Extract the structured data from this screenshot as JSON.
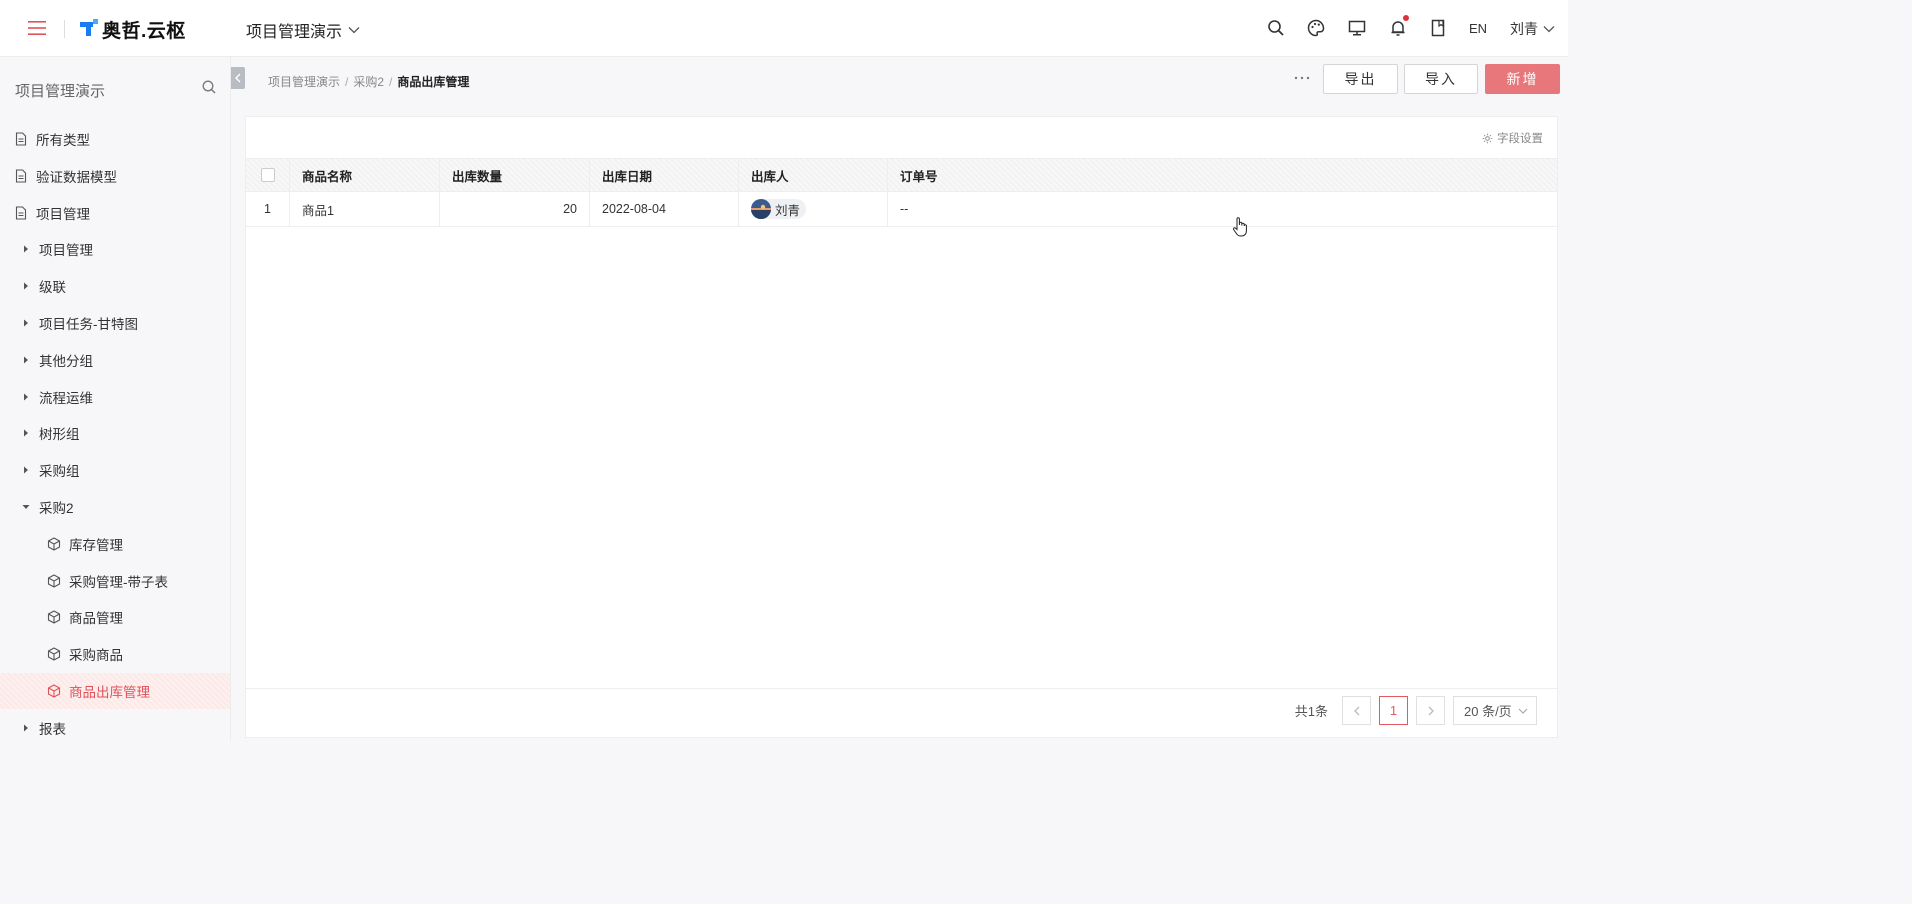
{
  "header": {
    "logo_text": "奥哲.云枢",
    "app_name": "项目管理演示",
    "lang": "EN",
    "user_name": "刘青",
    "icons": [
      "search-icon",
      "palette-icon",
      "monitor-icon",
      "bell-icon",
      "bookmark-icon"
    ]
  },
  "sidebar": {
    "title": "项目管理演示",
    "items": [
      {
        "label": "所有类型",
        "icon": "document-icon",
        "kind": "doc"
      },
      {
        "label": "验证数据模型",
        "icon": "document-icon",
        "kind": "doc"
      },
      {
        "label": "项目管理",
        "icon": "document-icon",
        "kind": "doc"
      },
      {
        "label": "项目管理",
        "icon": "caret-right-icon",
        "kind": "group"
      },
      {
        "label": "级联",
        "icon": "caret-right-icon",
        "kind": "group"
      },
      {
        "label": "项目任务-甘特图",
        "icon": "caret-right-icon",
        "kind": "group"
      },
      {
        "label": "其他分组",
        "icon": "caret-right-icon",
        "kind": "group"
      },
      {
        "label": "流程运维",
        "icon": "caret-right-icon",
        "kind": "group"
      },
      {
        "label": "树形组",
        "icon": "caret-right-icon",
        "kind": "group"
      },
      {
        "label": "采购组",
        "icon": "caret-right-icon",
        "kind": "group"
      },
      {
        "label": "采购2",
        "icon": "caret-down-icon",
        "kind": "group-open"
      },
      {
        "label": "库存管理",
        "icon": "cube-icon",
        "kind": "model"
      },
      {
        "label": "采购管理-带子表",
        "icon": "cube-icon",
        "kind": "model"
      },
      {
        "label": "商品管理",
        "icon": "cube-icon",
        "kind": "model"
      },
      {
        "label": "采购商品",
        "icon": "cube-icon",
        "kind": "model"
      },
      {
        "label": "商品出库管理",
        "icon": "cube-icon",
        "kind": "model",
        "active": true
      },
      {
        "label": "报表",
        "icon": "caret-right-icon",
        "kind": "group"
      }
    ]
  },
  "breadcrumb": {
    "items": [
      "项目管理演示",
      "采购2"
    ],
    "current": "商品出库管理"
  },
  "toolbar": {
    "export_label": "导出",
    "import_label": "导入",
    "new_label": "新增"
  },
  "panel": {
    "field_settings_label": "字段设置"
  },
  "table": {
    "columns": [
      "商品名称",
      "出库数量",
      "出库日期",
      "出库人",
      "订单号"
    ],
    "rows": [
      {
        "index": "1",
        "name": "商品1",
        "qty": "20",
        "date": "2022-08-04",
        "person": "刘青",
        "order_no": "--"
      }
    ]
  },
  "pagination": {
    "total_label": "共1条",
    "current_page": "1",
    "page_size_label": "20 条/页"
  },
  "colors": {
    "accent": "#e0525a",
    "primary_button": "#e8777b",
    "logo_blue": "#1a7cf0"
  }
}
